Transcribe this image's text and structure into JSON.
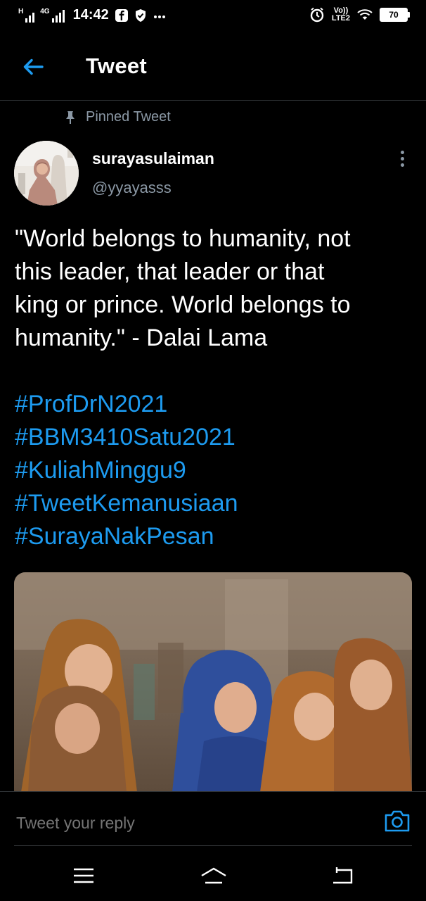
{
  "status_bar": {
    "network_1": "H",
    "network_2": "4G",
    "time": "14:42",
    "volte_top": "Vo))",
    "volte_bottom": "LTE2",
    "battery": "70",
    "icons": [
      "signal-icon",
      "signal-icon",
      "facebook-icon",
      "shield-icon",
      "more-notifications-icon",
      "alarm-icon",
      "wifi-icon",
      "battery-icon"
    ]
  },
  "header": {
    "title": "Tweet",
    "back_icon": "arrow-left-icon"
  },
  "tweet": {
    "pinned_label": "Pinned Tweet",
    "display_name": "surayasulaiman",
    "handle": "@yyayasss",
    "text_lines": [
      "\"World belongs to humanity, not",
      "this leader, that leader or that",
      "king or prince. World belongs to",
      "humanity.\" - Dalai Lama"
    ],
    "hashtags": [
      "#ProfDrN2021",
      "#BBM3410Satu2021",
      "#KuliahMinggu9",
      "#TweetKemanusiaan",
      "#SurayaNakPesan"
    ]
  },
  "reply": {
    "placeholder": "Tweet your reply",
    "camera_icon": "camera-icon"
  },
  "nav": {
    "icons": [
      "menu-icon",
      "home-icon",
      "back-icon"
    ]
  },
  "colors": {
    "background": "#000000",
    "accent": "#1d9bf0",
    "secondary_text": "#8b98a5",
    "divider": "#2f3336"
  }
}
